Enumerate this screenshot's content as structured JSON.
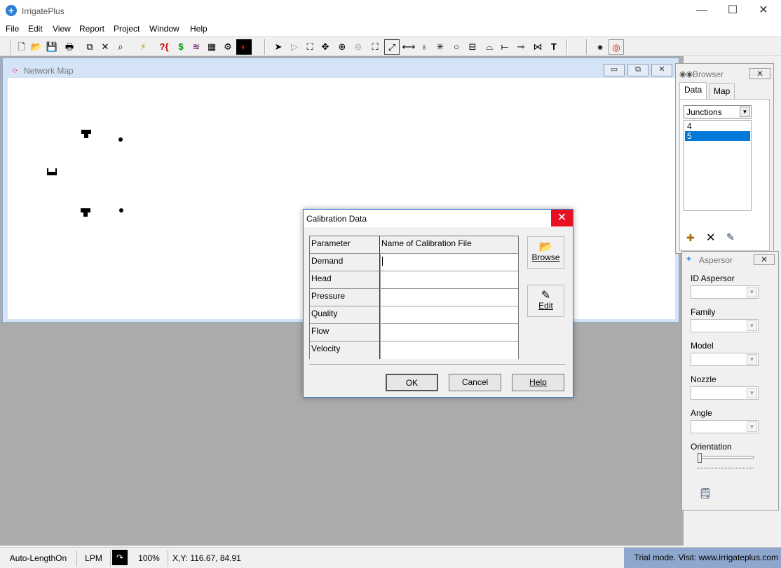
{
  "app": {
    "title": "IrrigatePlus"
  },
  "window_controls": {
    "minimize": "—",
    "maximize": "☐",
    "close": "✕"
  },
  "menu": [
    "File",
    "Edit",
    "View",
    "Report",
    "Project",
    "Window",
    "Help"
  ],
  "network_map": {
    "title": "Network Map"
  },
  "browser": {
    "title": "Browser",
    "tabs": [
      "Data",
      "Map"
    ],
    "category": "Junctions",
    "items": [
      "4",
      "5"
    ],
    "selected_index": 1
  },
  "aspersor": {
    "title": "Aspersor",
    "fields": [
      "ID Aspersor",
      "Family",
      "Model",
      "Nozzle",
      "Angle"
    ],
    "orientation_label": "Orientation"
  },
  "dialog": {
    "title": "Calibration Data",
    "header_param": "Parameter",
    "header_file": "Name of Calibration File",
    "rows": [
      {
        "param": "Demand",
        "file": ""
      },
      {
        "param": "Head",
        "file": ""
      },
      {
        "param": "Pressure",
        "file": ""
      },
      {
        "param": "Quality",
        "file": ""
      },
      {
        "param": "Flow",
        "file": ""
      },
      {
        "param": "Velocity",
        "file": ""
      }
    ],
    "browse_label": "Browse",
    "edit_label": "Edit",
    "ok_label": "OK",
    "cancel_label": "Cancel",
    "help_label": "Help"
  },
  "status": {
    "auto_length": "Auto-LengthOn",
    "units": "LPM",
    "zoom": "100%",
    "coords": "X,Y: 116.67, 84.91",
    "trial": "Trial mode. Visit: www.irrigateplus.com"
  },
  "colors": {
    "accent": "#0078d7",
    "dialog_close": "#e81123",
    "trial_bg": "#8fa7cd"
  }
}
